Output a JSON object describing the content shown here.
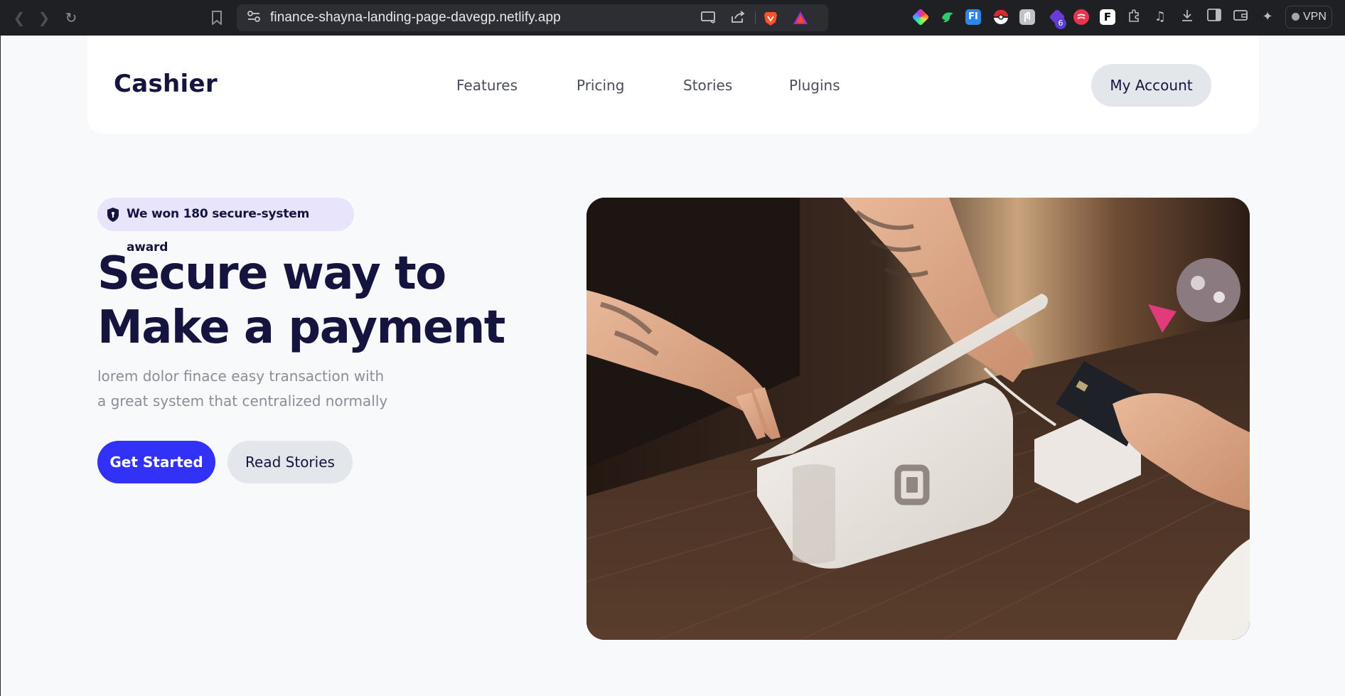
{
  "browser": {
    "url": "finance-shayna-landing-page-davegp.netlify.app",
    "extension_badge_count": "6",
    "vpn_label": "VPN",
    "icons": [
      "back-icon",
      "forward-icon",
      "reload-icon",
      "bookmark-icon",
      "site-settings-icon",
      "cast-icon",
      "share-icon",
      "brave-shield-icon",
      "brave-rewards-icon",
      "extensions-icon",
      "media-icon",
      "downloads-icon",
      "sidebar-icon",
      "wallet-icon",
      "leo-ai-icon"
    ]
  },
  "header": {
    "logo": "Cashier",
    "menu": [
      "Features",
      "Pricing",
      "Stories",
      "Plugins"
    ],
    "account_button": "My Account"
  },
  "hero": {
    "badge_text": "We won 180 secure-system award",
    "headline_line1": "Secure way to",
    "headline_line2": "Make a payment",
    "subtitle_line1": "lorem dolor finace easy transaction with",
    "subtitle_line2": "a great system that centralized normally",
    "primary_button": "Get Started",
    "secondary_button": "Read Stories",
    "image": "card-payment-terminal-photo"
  },
  "colors": {
    "brand_dark": "#15143e",
    "primary_blue": "#3131f7",
    "badge_bg": "#e7e4fb",
    "muted_text": "#8a8e99",
    "button_gray": "#e3e6ea"
  }
}
